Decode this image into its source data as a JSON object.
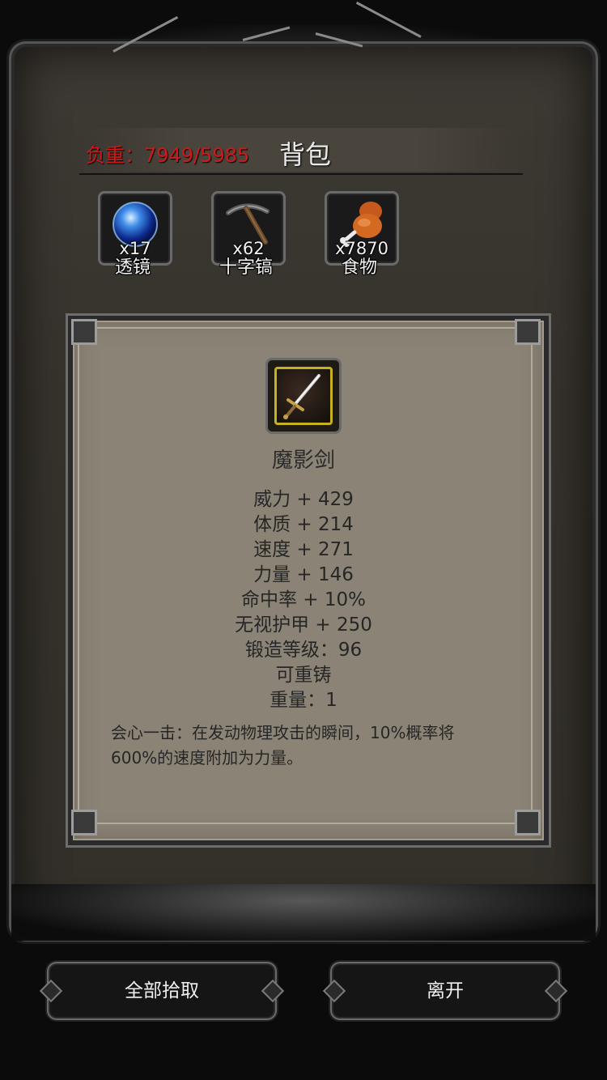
{
  "header": {
    "weight_text": "负重：7949/5985",
    "title": "背包"
  },
  "inventory": [
    {
      "name": "透镜",
      "qty": "x17",
      "icon": "lens-orb-icon"
    },
    {
      "name": "十字镐",
      "qty": "x62",
      "icon": "pickaxe-icon"
    },
    {
      "name": "食物",
      "qty": "x7870",
      "icon": "meat-drumstick-icon"
    }
  ],
  "item_detail": {
    "name": "魔影剑",
    "stats": [
      "威力 + 429",
      "体质 + 214",
      "速度 + 271",
      "力量 + 146",
      "命中率 + 10%",
      "无视护甲 + 250",
      "锻造等级：96",
      "可重铸",
      "重量：1"
    ],
    "description": "会心一击：在发动物理攻击的瞬间，10%概率将600%的速度附加为力量。"
  },
  "buttons": {
    "pickup_all": "全部拾取",
    "leave": "离开"
  },
  "colors": {
    "weight_warning": "#d21818",
    "panel_bg": "#8b8476",
    "frame_bg": "#36322c",
    "rarity_border": "#c8b11e"
  }
}
